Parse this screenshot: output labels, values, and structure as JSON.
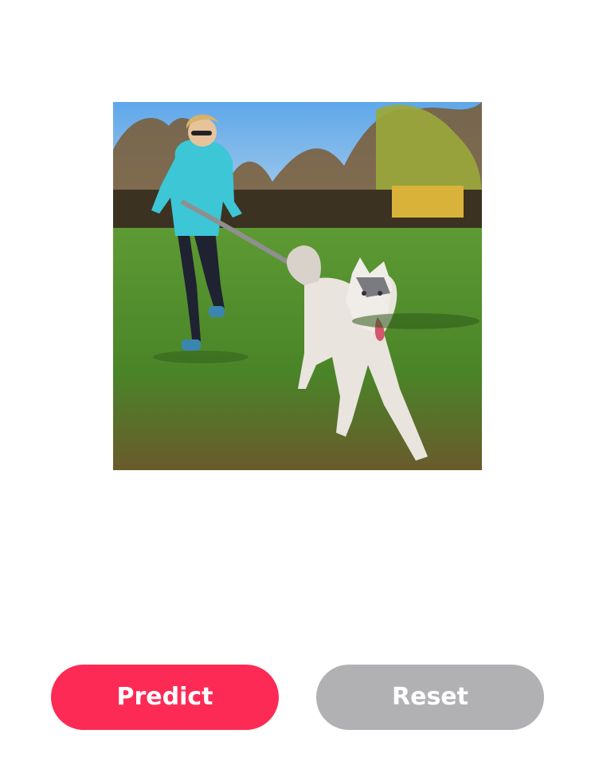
{
  "image": {
    "alt": "",
    "colors": {
      "sky": "#7fb6e6",
      "grass": "#4f8a2c",
      "jacket": "#3cc6d6",
      "dog": "#e9e4de"
    }
  },
  "buttons": {
    "predict_label": "Predict",
    "reset_label": "Reset"
  },
  "colors": {
    "predict": "#fd2a55",
    "reset": "#b1b0b3",
    "background": "#ffffff"
  }
}
